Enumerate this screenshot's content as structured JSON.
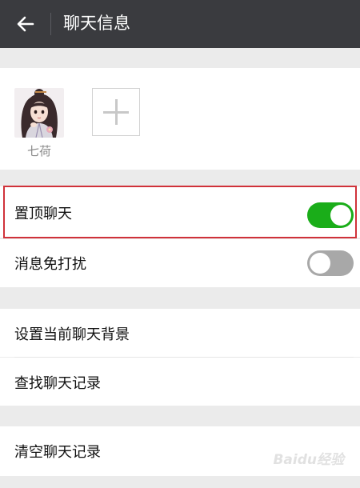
{
  "header": {
    "title": "聊天信息",
    "back_icon": "arrow-left-icon"
  },
  "members": [
    {
      "name": "七荷",
      "avatar": "girl-avatar"
    }
  ],
  "add_member_icon": "plus-icon",
  "settings": {
    "pin_chat": {
      "label": "置顶聊天",
      "enabled": true
    },
    "do_not_disturb": {
      "label": "消息免打扰",
      "enabled": false
    },
    "set_background": {
      "label": "设置当前聊天背景"
    },
    "find_history": {
      "label": "查找聊天记录"
    },
    "clear_history": {
      "label": "清空聊天记录"
    }
  },
  "watermark": {
    "text": "Baidu经验"
  },
  "colors": {
    "header_bg": "#3a3b3f",
    "toggle_on": "#1aad19",
    "toggle_off": "#a8a8a8",
    "highlight_border": "#d0323a",
    "page_bg": "#ebebeb"
  }
}
